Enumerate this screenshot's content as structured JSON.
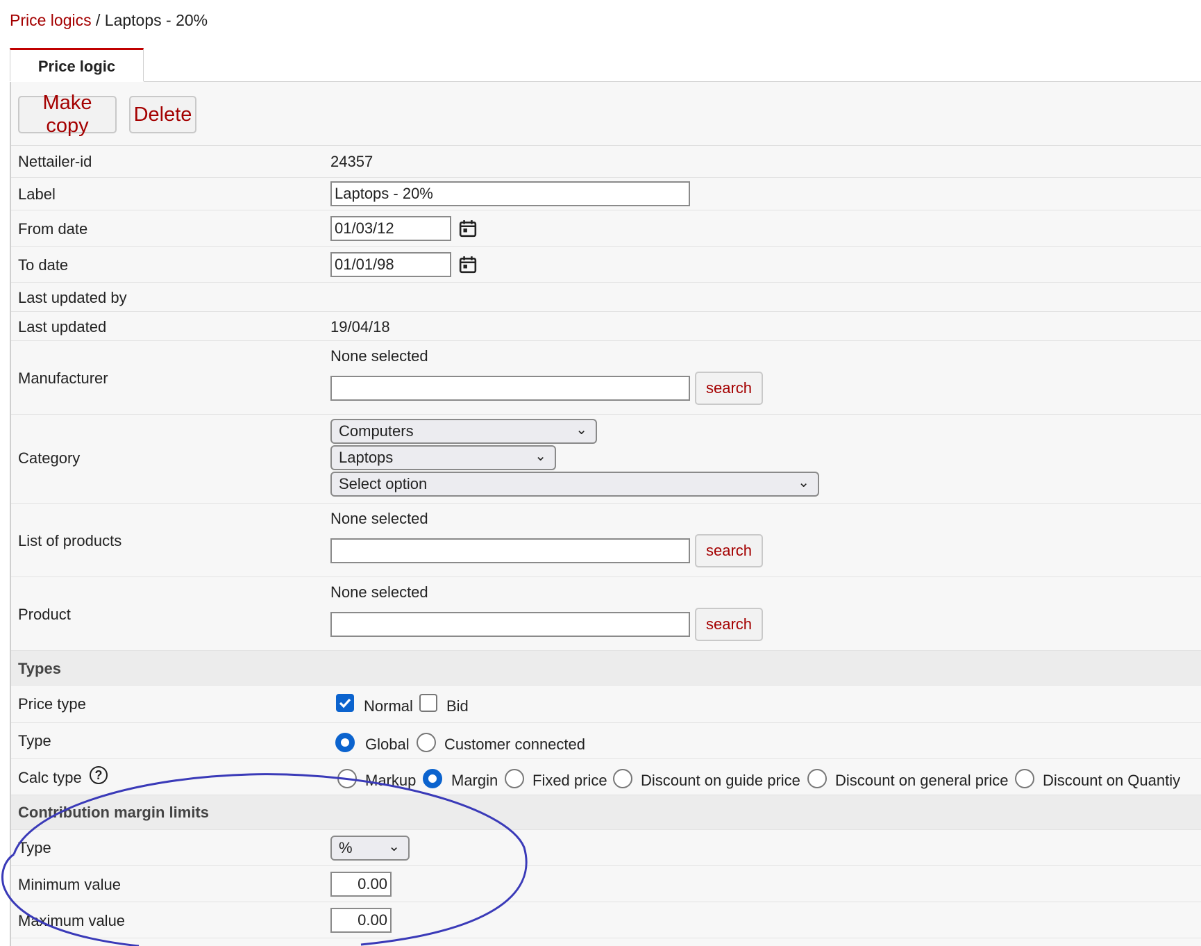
{
  "breadcrumb": {
    "parent": "Price logics",
    "separator": " / ",
    "current": "Laptops - 20%"
  },
  "tab": {
    "label": "Price logic"
  },
  "toolbar": {
    "copy_label": "Make copy",
    "delete_label": "Delete"
  },
  "fields": {
    "nettailer_id": {
      "label": "Nettailer-id",
      "value": "24357"
    },
    "label": {
      "label": "Label",
      "value": "Laptops - 20%"
    },
    "from_date": {
      "label": "From date",
      "value": "01/03/12"
    },
    "to_date": {
      "label": "To date",
      "value": "01/01/98"
    },
    "last_updated_by": {
      "label": "Last updated by",
      "value": ""
    },
    "last_updated": {
      "label": "Last updated",
      "value": "19/04/18"
    },
    "manufacturer": {
      "label": "Manufacturer",
      "status": "None selected",
      "search_label": "search",
      "value": ""
    },
    "category": {
      "label": "Category",
      "level1": "Computers",
      "level2": "Laptops",
      "level3": "Select option"
    },
    "list_of_products": {
      "label": "List of products",
      "status": "None selected",
      "search_label": "search",
      "value": ""
    },
    "product": {
      "label": "Product",
      "status": "None selected",
      "search_label": "search",
      "value": ""
    }
  },
  "types_section": {
    "heading": "Types",
    "price_type": {
      "label": "Price type",
      "options": [
        {
          "label": "Normal",
          "checked": true
        },
        {
          "label": "Bid",
          "checked": false
        }
      ]
    },
    "type": {
      "label": "Type",
      "options": [
        {
          "label": "Global",
          "selected": true
        },
        {
          "label": "Customer connected",
          "selected": false
        }
      ]
    },
    "calc_type": {
      "label": "Calc type",
      "help_icon": "question-circle-icon",
      "help_glyph": "?",
      "options": [
        {
          "label": "Markup",
          "selected": false
        },
        {
          "label": "Margin",
          "selected": true
        },
        {
          "label": "Fixed price",
          "selected": false
        },
        {
          "label": "Discount on guide price",
          "selected": false
        },
        {
          "label": "Discount on general price",
          "selected": false
        },
        {
          "label": "Discount on Quantiy",
          "selected": false
        }
      ]
    }
  },
  "margin_section": {
    "heading": "Contribution margin limits",
    "type": {
      "label": "Type",
      "value": "%"
    },
    "minimum": {
      "label": "Minimum value",
      "value": "0.00"
    },
    "maximum": {
      "label": "Maximum value",
      "value": "0.00"
    }
  },
  "icons": {
    "calendar": "calendar-icon",
    "chevron": "chevron-down-icon",
    "chevron_glyph": "⌄"
  },
  "colors": {
    "link": "#a40000",
    "tab_accent": "#c00000",
    "accent": "#0b63ce",
    "annotation": "#3a3ab8"
  }
}
